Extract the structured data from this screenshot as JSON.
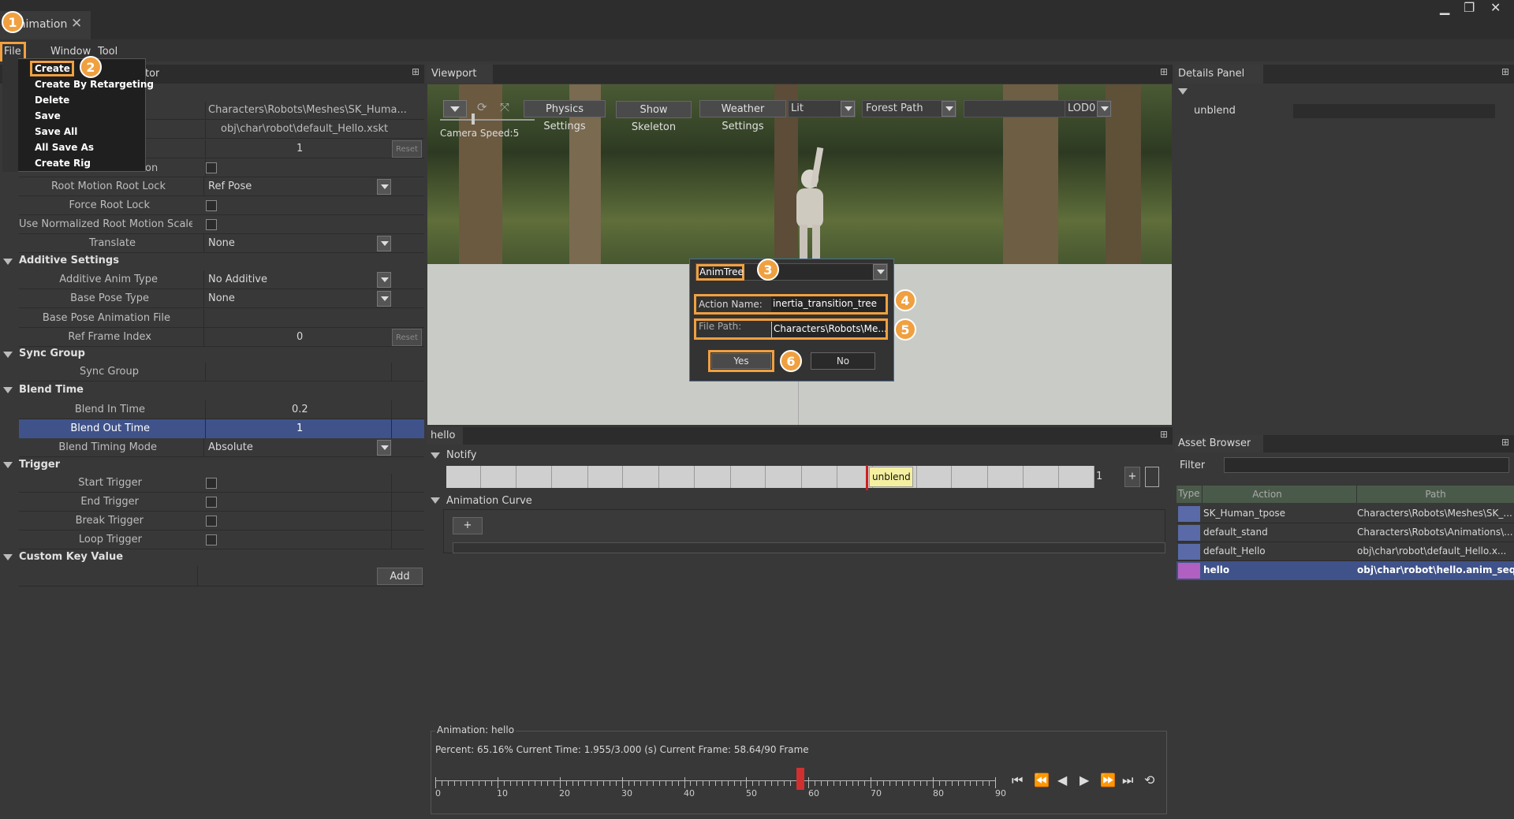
{
  "titlebar": {
    "tab_title": "Animation"
  },
  "menu": {
    "file": "File",
    "window": "Window",
    "tool": "Tool"
  },
  "file_menu": {
    "items": [
      "Create",
      "Create By Retargeting",
      "Delete",
      "Save",
      "Save All",
      "All Save As",
      "Create Rig"
    ]
  },
  "left_panel": {
    "title_partial": "tor",
    "skeleton_path": "Characters\\Robots\\Meshes\\SK_Huma...",
    "xskt_path": "obj\\char\\robot\\default_Hello.xskt",
    "value_one": "1",
    "reset_label": "Reset",
    "partial_label_on": "on",
    "root_motion_root_lock_label": "Root Motion Root Lock",
    "root_motion_root_lock_value": "Ref Pose",
    "force_root_lock_label": "Force Root Lock",
    "use_normalized_label": "Use Normalized Root Motion Scale",
    "translate_label": "Translate",
    "translate_value": "None",
    "additive_settings": "Additive Settings",
    "additive_anim_type_label": "Additive Anim Type",
    "additive_anim_type_value": "No Additive",
    "base_pose_type_label": "Base Pose Type",
    "base_pose_type_value": "None",
    "base_pose_anim_file_label": "Base Pose Animation File",
    "ref_frame_index_label": "Ref Frame Index",
    "ref_frame_index_value": "0",
    "sync_group_header": "Sync Group",
    "sync_group_label": "Sync Group",
    "blend_time_header": "Blend Time",
    "blend_in_time_label": "Blend In Time",
    "blend_in_time_value": "0.2",
    "blend_out_time_label": "Blend Out Time",
    "blend_out_time_value": "1",
    "blend_timing_mode_label": "Blend Timing Mode",
    "blend_timing_mode_value": "Absolute",
    "trigger_header": "Trigger",
    "start_trigger_label": "Start Trigger",
    "end_trigger_label": "End Trigger",
    "break_trigger_label": "Break Trigger",
    "loop_trigger_label": "Loop Trigger",
    "custom_key_value_header": "Custom Key Value",
    "add_label": "Add"
  },
  "viewport": {
    "title": "Viewport",
    "physics_settings": "Physics Settings",
    "show_skeleton": "Show Skeleton",
    "weather_settings": "Weather Settings",
    "lit": "Lit",
    "forest_path": "Forest Path",
    "lod": "LOD0",
    "camera_speed": "Camera Speed:5"
  },
  "dialog": {
    "type_value": "AnimTree",
    "action_name_label": "Action Name:",
    "action_name_value": "inertia_transition_tree",
    "file_path_label": "File Path:",
    "file_path_value": "Characters\\Robots\\Me...",
    "yes": "Yes",
    "no": "No"
  },
  "badges": [
    "1",
    "2",
    "3",
    "4",
    "5",
    "6"
  ],
  "details_panel": {
    "title": "Details Panel",
    "item": "unblend"
  },
  "timeline": {
    "tab": "hello",
    "notify_header": "Notify",
    "notify_marker": "unblend",
    "notify_count": "1",
    "plus": "+",
    "animation_curve_header": "Animation Curve",
    "curve_plus": "+"
  },
  "playback": {
    "group_title": "Animation: hello",
    "status": "Percent: 65.16% Current Time: 1.955/3.000 (s) Current Frame: 58.64/90 Frame",
    "scale_labels": [
      "0",
      "10",
      "20",
      "30",
      "40",
      "50",
      "60",
      "70",
      "80",
      "90"
    ],
    "scale_max": 90,
    "current_frame": 58.64
  },
  "asset_browser": {
    "title": "Asset Browser",
    "filter_label": "Filter",
    "columns": [
      "Type",
      "Action",
      "Path"
    ],
    "rows": [
      {
        "action": "SK_Human_tpose",
        "path": "Characters\\Robots\\Meshes\\SK_..."
      },
      {
        "action": "default_stand",
        "path": "Characters\\Robots\\Animations\\..."
      },
      {
        "action": "default_Hello",
        "path": "obj\\char\\robot\\default_Hello.x..."
      },
      {
        "action": "hello",
        "path": "obj\\char\\robot\\hello.anim_seq..."
      }
    ]
  },
  "colors": {
    "accent": "#f0a040",
    "selected_row": "#3f5289",
    "panel_bg": "#383838"
  }
}
